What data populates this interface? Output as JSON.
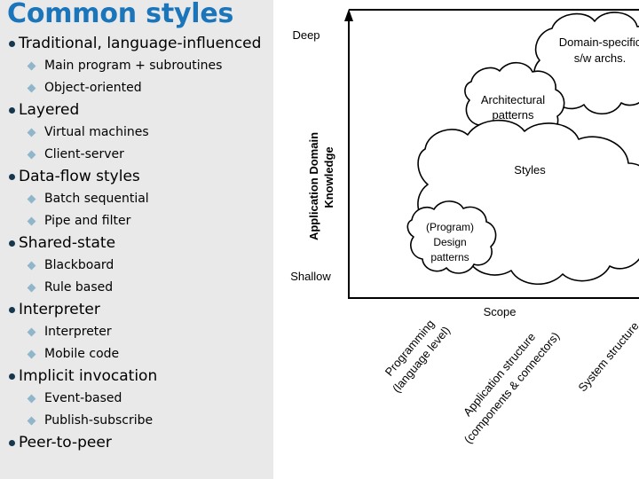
{
  "slide": {
    "title": "Common styles",
    "title_color": "#1b75bb",
    "panel_bg": "#e9e9e9",
    "bullet_level1_color": "#17374f",
    "bullet_level2_color": "#8fb6ca"
  },
  "bullets": [
    {
      "level": 1,
      "text": "Traditional, language-influenced"
    },
    {
      "level": 2,
      "text": "Main program + subroutines"
    },
    {
      "level": 2,
      "text": "Object-oriented"
    },
    {
      "level": 1,
      "text": "Layered"
    },
    {
      "level": 2,
      "text": "Virtual machines"
    },
    {
      "level": 2,
      "text": "Client-server"
    },
    {
      "level": 1,
      "text": "Data-flow styles"
    },
    {
      "level": 2,
      "text": "Batch sequential"
    },
    {
      "level": 2,
      "text": "Pipe and filter"
    },
    {
      "level": 1,
      "text": "Shared-state"
    },
    {
      "level": 2,
      "text": "Blackboard"
    },
    {
      "level": 2,
      "text": "Rule based"
    },
    {
      "level": 1,
      "text": "Interpreter"
    },
    {
      "level": 2,
      "text": "Interpreter"
    },
    {
      "level": 2,
      "text": "Mobile code"
    },
    {
      "level": 1,
      "text": "Implicit invocation"
    },
    {
      "level": 2,
      "text": "Event-based"
    },
    {
      "level": 2,
      "text": "Publish-subscribe"
    },
    {
      "level": 1,
      "text": "Peer-to-peer"
    }
  ],
  "diagram": {
    "y_axis": {
      "label_line1": "Application Domain",
      "label_line2": "Knowledge",
      "top_tick": "Deep",
      "bottom_tick": "Shallow"
    },
    "x_axis": {
      "label": "Scope",
      "ticks": [
        {
          "line1": "Programming",
          "line2": "(language level)"
        },
        {
          "line1": "Application structure",
          "line2": "(components & connectors)"
        },
        {
          "line1": "System structure",
          "line2": ""
        }
      ]
    },
    "clouds": [
      {
        "name": "design-patterns-cloud",
        "line1": "(Program)",
        "line2": "Design",
        "line3": "patterns"
      },
      {
        "name": "architectural-patterns-cloud",
        "line1": "Architectural",
        "line2": "patterns",
        "line3": ""
      },
      {
        "name": "styles-cloud",
        "line1": "Styles",
        "line2": "",
        "line3": ""
      },
      {
        "name": "domain-specific-cloud",
        "line1": "Domain-specific",
        "line2": "s/w archs.",
        "line3": ""
      }
    ]
  }
}
